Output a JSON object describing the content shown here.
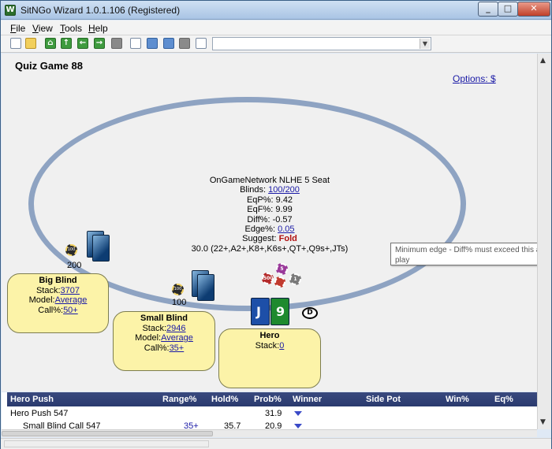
{
  "window": {
    "app_icon": "sitngo-app-icon",
    "title": "SitNGo Wizard 1.0.1.106 (Registered)",
    "controls": [
      "minimize-icon",
      "maximize-icon",
      "close-icon"
    ]
  },
  "menu": [
    {
      "label": "File"
    },
    {
      "label": "View"
    },
    {
      "label": "Tools"
    },
    {
      "label": "Help"
    }
  ],
  "toolbar": {
    "icons": [
      "new-file-icon",
      "open-folder-icon",
      "home-icon",
      "arrow-up-icon",
      "arrow-left-icon",
      "arrow-right-icon",
      "stop-icon",
      "copy-icon",
      "save-image-icon",
      "picture-icon",
      "stop-icon",
      "report-icon"
    ],
    "combo_value": ""
  },
  "main": {
    "title": "Quiz Game 88",
    "options_link": "Options: $",
    "center": {
      "line1": "OnGameNetwork NLHE 5 Seat",
      "blinds_label": "Blinds:",
      "blinds_value": "100/200",
      "eqp_label": "EqP%:",
      "eqp_value": "9.42",
      "eqf_label": "EqF%:",
      "eqf_value": "9.99",
      "diff_label": "Diff%:",
      "diff_value": "-0.57",
      "edge_label": "Edge%:",
      "edge_value": "0.05",
      "suggest_label": "Suggest:",
      "suggest_value": "Fold",
      "range_line": "30.0 (22+,A2+,K8+,K6s+,QT+,Q9s+,JTs)"
    },
    "tooltip": {
      "line1": "Minimum edge - Diff% must exceed this am",
      "line2": "play"
    },
    "seats": {
      "big_blind": {
        "name": "Big Blind",
        "stack_label": "Stack:",
        "stack_value": "3707",
        "model_label": "Model:",
        "model_value": "Average",
        "call_label": "Call%:",
        "call_value": "50+",
        "bet": "200",
        "chip_label": "100"
      },
      "small_blind": {
        "name": "Small Blind",
        "stack_label": "Stack:",
        "stack_value": "2946",
        "model_label": "Model:",
        "model_value": "Average",
        "call_label": "Call%:",
        "call_value": "35+",
        "bet": "100",
        "chip_label": "100"
      },
      "hero": {
        "name": "Hero",
        "stack_label": "Stack:",
        "stack_value": "0",
        "cards": [
          "J",
          "9"
        ],
        "dealer_button": "D"
      }
    },
    "pot_chips": [
      {
        "label": "500",
        "color": "#b42a2a"
      },
      {
        "label": "5",
        "color": "#9a3a9a"
      },
      {
        "label": "1",
        "color": "#7a7a7a"
      }
    ]
  },
  "results": {
    "columns": [
      "Hero Push",
      "Range%",
      "Hold%",
      "Prob%",
      "Winner",
      "Side Pot",
      "Win%",
      "Eq%"
    ],
    "rows": [
      {
        "hero_push": "Hero Push 547",
        "range": "",
        "hold": "",
        "prob": "31.9",
        "winner": "expand-icon",
        "side_pot": "",
        "win": "",
        "eq": ""
      },
      {
        "hero_push": "Small Blind Call 547",
        "range": "35+",
        "hold": "35.7",
        "prob": "20.9",
        "winner": "expand-icon",
        "side_pot": "",
        "win": "",
        "eq": ""
      }
    ]
  }
}
